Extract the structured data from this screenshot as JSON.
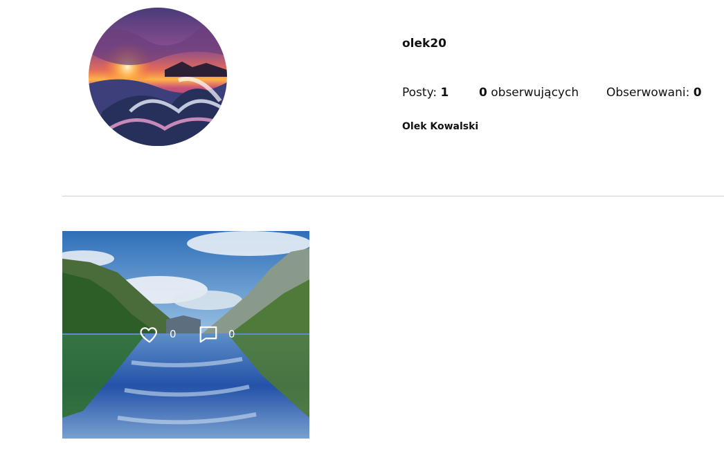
{
  "profile": {
    "username": "olek20",
    "full_name": "Olek Kowalski",
    "avatar_icon": "profile-avatar-sunset-waves"
  },
  "stats": {
    "posts_label": "Posty:",
    "posts_count": "1",
    "followers_count": "0",
    "followers_label": "obserwujących",
    "following_label": "Obserwowani:",
    "following_count": "0"
  },
  "posts": [
    {
      "image_icon": "lake-mountains-photo",
      "likes": "0",
      "comments": "0",
      "like_icon": "heart-icon",
      "comment_icon": "comment-icon"
    }
  ],
  "colors": {
    "divider": "#cfcfcf",
    "overlay_text": "#ffffff"
  }
}
